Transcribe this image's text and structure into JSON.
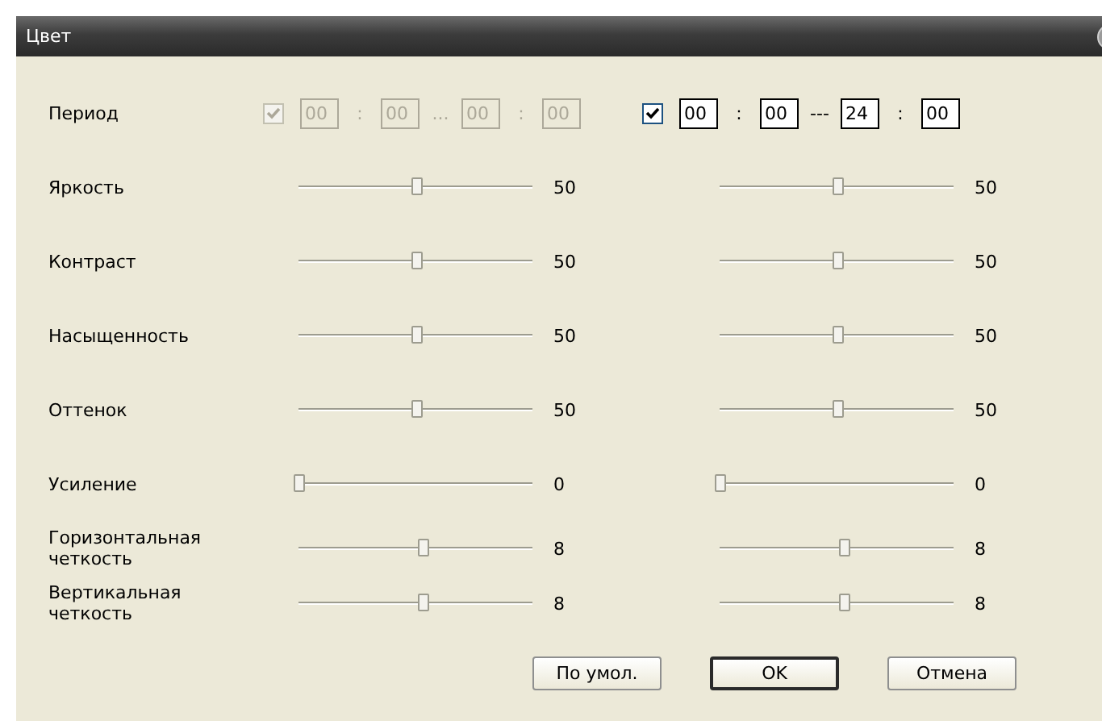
{
  "window": {
    "title": "Цвет"
  },
  "period": {
    "label": "Период",
    "schedules": [
      {
        "disabled": true,
        "checked": true,
        "fields": [
          "00",
          "00",
          "00",
          "00"
        ],
        "separators": [
          ":",
          "...",
          ":"
        ]
      },
      {
        "disabled": false,
        "checked": true,
        "fields": [
          "00",
          "00",
          "24",
          "00"
        ],
        "separators": [
          ":",
          "---",
          ":"
        ]
      }
    ]
  },
  "sliders": [
    {
      "label": "Яркость",
      "left": {
        "level": 0.5,
        "reading": "50"
      },
      "right": {
        "level": 0.5,
        "reading": "50"
      }
    },
    {
      "label": "Контраст",
      "left": {
        "level": 0.5,
        "reading": "50"
      },
      "right": {
        "level": 0.5,
        "reading": "50"
      }
    },
    {
      "label": "Насыщенность",
      "left": {
        "level": 0.5,
        "reading": "50"
      },
      "right": {
        "level": 0.5,
        "reading": "50"
      }
    },
    {
      "label": "Оттенок",
      "left": {
        "level": 0.5,
        "reading": "50"
      },
      "right": {
        "level": 0.5,
        "reading": "50"
      }
    },
    {
      "label": "Усиление",
      "left": {
        "level": 0,
        "reading": "0"
      },
      "right": {
        "level": 0,
        "reading": "0"
      }
    },
    {
      "label": "Горизонтальная четкость",
      "left": {
        "level": 0.53,
        "reading": "8"
      },
      "right": {
        "level": 0.53,
        "reading": "8"
      }
    },
    {
      "label": "Вертикальная четкость",
      "left": {
        "level": 0.53,
        "reading": "8"
      },
      "right": {
        "level": 0.53,
        "reading": "8"
      }
    }
  ],
  "buttons": [
    {
      "label": "По умол.",
      "default": false
    },
    {
      "label": "OK",
      "default": true
    },
    {
      "label": "Отмена",
      "default": false
    }
  ]
}
